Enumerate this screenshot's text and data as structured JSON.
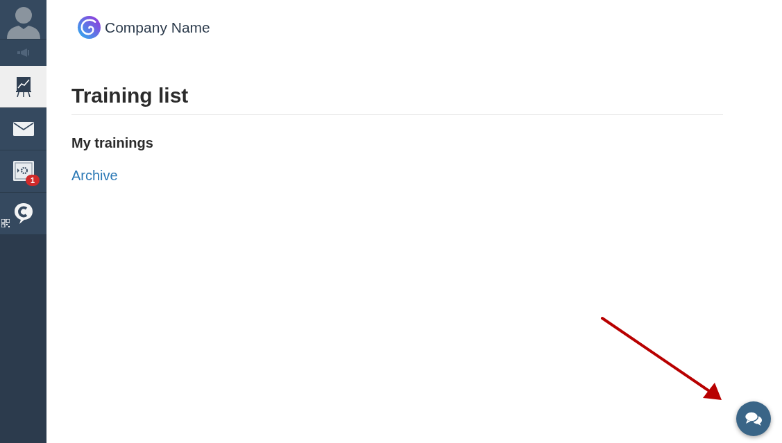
{
  "sidebar": {
    "items": [
      {
        "kind": "chart",
        "selected": true
      },
      {
        "kind": "mail",
        "selected": false
      },
      {
        "kind": "safe",
        "selected": false,
        "badge": "1"
      },
      {
        "kind": "chat",
        "selected": false
      }
    ]
  },
  "header": {
    "company_name": "Company Name"
  },
  "page": {
    "title": "Training list",
    "section": "My trainings",
    "link": "Archive"
  }
}
